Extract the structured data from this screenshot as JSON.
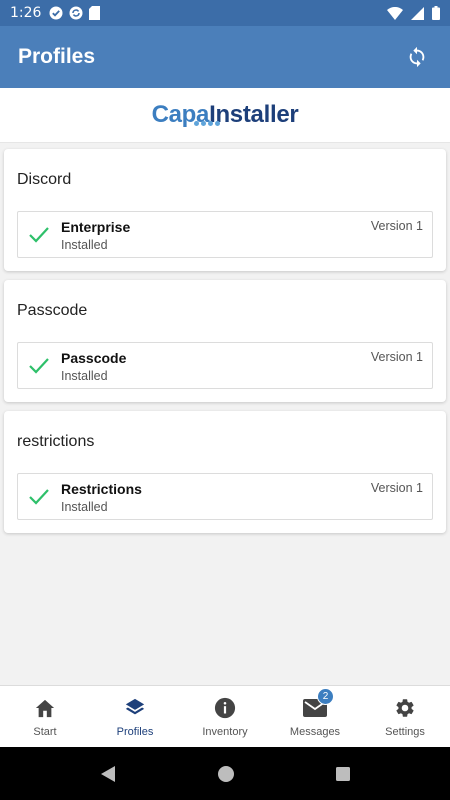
{
  "status_bar": {
    "time": "1:26",
    "icons": [
      "check-circle-icon",
      "sync-icon",
      "sd-card-icon",
      "wifi-icon",
      "signal-icon",
      "battery-icon"
    ]
  },
  "header": {
    "title": "Profiles",
    "action_icon": "sync-icon"
  },
  "logo": {
    "capa": "Capa",
    "installer": "Installer"
  },
  "profiles": [
    {
      "title": "Discord",
      "item": {
        "name": "Enterprise",
        "status": "Installed",
        "version": "Version 1"
      }
    },
    {
      "title": "Passcode",
      "item": {
        "name": "Passcode",
        "status": "Installed",
        "version": "Version 1"
      }
    },
    {
      "title": "restrictions",
      "item": {
        "name": "Restrictions",
        "status": "Installed",
        "version": "Version 1"
      }
    }
  ],
  "bottom_nav": {
    "items": [
      {
        "label": "Start",
        "icon": "home-icon"
      },
      {
        "label": "Profiles",
        "icon": "layers-icon",
        "active": true
      },
      {
        "label": "Inventory",
        "icon": "info-icon"
      },
      {
        "label": "Messages",
        "icon": "mail-icon",
        "badge": "2"
      },
      {
        "label": "Settings",
        "icon": "gear-icon"
      }
    ]
  },
  "colors": {
    "status_bar": "#3c6da8",
    "app_bar": "#4b7fba",
    "check": "#2ec06a",
    "active_nav": "#1d3f7a",
    "badge": "#3c7ec0"
  }
}
